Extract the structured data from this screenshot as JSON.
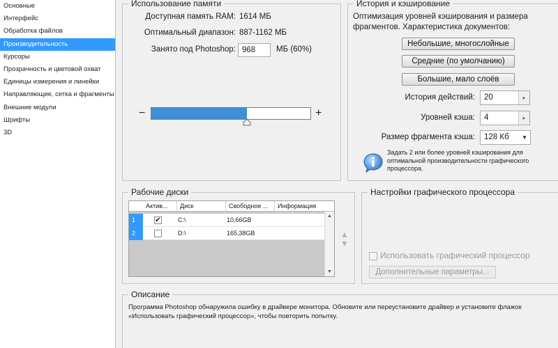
{
  "sidebar": {
    "items": [
      {
        "label": "Основные"
      },
      {
        "label": "Интерфейс"
      },
      {
        "label": "Обработка файлов"
      },
      {
        "label": "Производительность"
      },
      {
        "label": "Курсоры"
      },
      {
        "label": "Прозрачность и цветовой охват"
      },
      {
        "label": "Единицы измерения и линейки"
      },
      {
        "label": "Направляющие, сетка и фрагменты"
      },
      {
        "label": "Внешние модули"
      },
      {
        "label": "Шрифты"
      },
      {
        "label": "3D"
      }
    ],
    "selected_index": 3
  },
  "memory": {
    "title": "Использование памяти",
    "available_label": "Доступная память RAM:",
    "available_value": "1614 МБ",
    "optimal_label": "Оптимальный диапазон:",
    "optimal_value": "887-1162 МБ",
    "used_label": "Занято под Photoshop:",
    "used_value": "968",
    "used_unit": "МБ (60%)",
    "slider_fraction": 0.6,
    "minus": "−",
    "plus": "+"
  },
  "history": {
    "title": "История и кэширование",
    "description": "Оптимизация уровней кэширования и размера фрагментов. Характеристика документов:",
    "btn_small": "Небольшие, многослойные",
    "btn_medium": "Средние (по умолчанию)",
    "btn_large": "Большие, мало слоёв",
    "history_label": "История действий:",
    "history_value": "20",
    "cache_label": "Уровней кэша:",
    "cache_value": "4",
    "tile_label": "Размер фрагмента кэша:",
    "tile_value": "128 Кб",
    "tip": "Задать 2 или более уровней кэширования для оптимальной производительности графического процессора."
  },
  "disks": {
    "title": "Рабочие диски",
    "columns": [
      "Актив...",
      "Диск",
      "Свободное ...",
      "Информация"
    ],
    "rows": [
      {
        "num": "1",
        "active": "✔",
        "disk": "C:\\",
        "free": "10,66GB",
        "info": ""
      },
      {
        "num": "2",
        "active": "",
        "disk": "D:\\",
        "free": "165,38GB",
        "info": ""
      }
    ],
    "up_arrow": "▲",
    "down_arrow": "▼"
  },
  "gpu": {
    "title": "Настройки графического процессора",
    "use_gpu_label": "Использовать графический процессор",
    "advanced_button": "Дополнительные параметры..."
  },
  "description": {
    "title": "Описание",
    "text": "Программа Photoshop обнаружила ошибку в драйвере монитора. Обновите или переустановите драйвер и установите флажок «Использовать графический процессор», чтобы повторить попытку."
  },
  "colors": {
    "selection": "#3399ff",
    "slider_fill": "#3e8fd6"
  }
}
